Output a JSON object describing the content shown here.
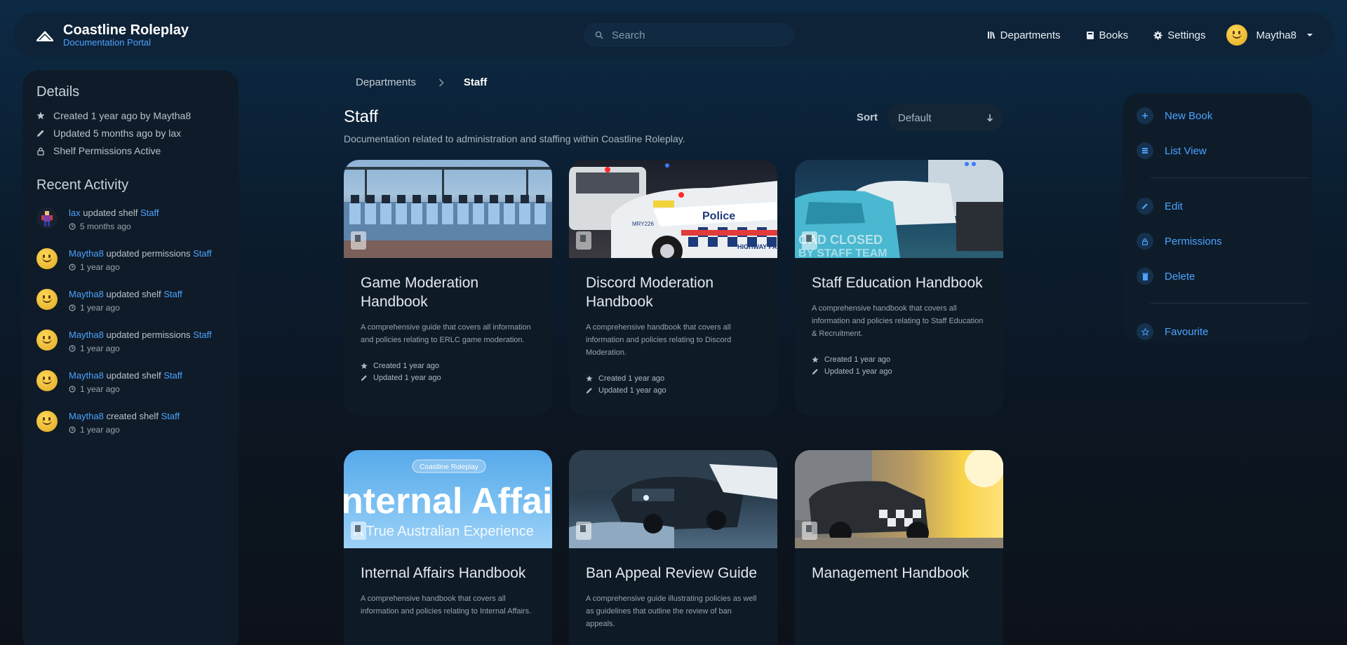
{
  "header": {
    "brand_title": "Coastline Roleplay",
    "brand_subtitle": "Documentation Portal",
    "search_placeholder": "Search",
    "nav": [
      {
        "label": "Departments",
        "icon": "departments-icon"
      },
      {
        "label": "Books",
        "icon": "books-icon"
      },
      {
        "label": "Settings",
        "icon": "gear-icon"
      }
    ],
    "user_name": "Maytha8"
  },
  "details": {
    "heading": "Details",
    "rows": [
      {
        "icon": "star-icon",
        "text": "Created 1 year ago by Maytha8"
      },
      {
        "icon": "pencil-icon",
        "text": "Updated 5 months ago by lax"
      },
      {
        "icon": "lock-icon",
        "text": "Shelf Permissions Active"
      }
    ]
  },
  "recent_activity": {
    "heading": "Recent Activity",
    "items": [
      {
        "user": "lax",
        "action": "updated shelf",
        "target": "Staff",
        "time": "5 months ago"
      },
      {
        "user": "Maytha8",
        "action": "updated permissions",
        "target": "Staff",
        "time": "1 year ago"
      },
      {
        "user": "Maytha8",
        "action": "updated shelf",
        "target": "Staff",
        "time": "1 year ago"
      },
      {
        "user": "Maytha8",
        "action": "updated permissions",
        "target": "Staff",
        "time": "1 year ago"
      },
      {
        "user": "Maytha8",
        "action": "updated shelf",
        "target": "Staff",
        "time": "1 year ago"
      },
      {
        "user": "Maytha8",
        "action": "created shelf",
        "target": "Staff",
        "time": "1 year ago"
      }
    ]
  },
  "breadcrumb": {
    "parent": "Departments",
    "current": "Staff"
  },
  "main": {
    "title": "Staff",
    "description": "Documentation related to administration and staffing within Coastline Roleplay.",
    "sort_label": "Sort",
    "sort_value": "Default"
  },
  "books": [
    {
      "title": "Game Moderation Handbook",
      "desc": "A comprehensive guide that covers all information and policies relating to ERLC game moderation.",
      "created": "Created 1 year ago",
      "updated": "Updated 1 year ago"
    },
    {
      "title": "Discord Moderation Handbook",
      "desc": "A comprehensive handbook that covers all information and policies relating to Discord Moderation.",
      "created": "Created 1 year ago",
      "updated": "Updated 1 year ago"
    },
    {
      "title": "Staff Education Handbook",
      "desc": "A comprehensive handbook that covers all information and policies relating to Staff Education & Recruitment.",
      "created": "Created 1 year ago",
      "updated": "Updated 1 year ago"
    },
    {
      "title": "Internal Affairs Handbook",
      "desc": "A comprehensive handbook that covers all information and policies relating to Internal Affairs.",
      "cover_text_top": "Coastline Roleplay",
      "cover_text_main": "nternal Affai",
      "cover_text_sub": "A True Australian Experience"
    },
    {
      "title": "Ban Appeal Review Guide",
      "desc": "A comprehensive guide illustrating policies as well as guidelines that outline the review of ban appeals."
    },
    {
      "title": "Management Handbook",
      "desc": ""
    }
  ],
  "cover_text": {
    "card2_police": "Police",
    "card2_plate": "MRY226",
    "card2_highway": "HIGHWAY PA",
    "card3_sign_1": "OAD CLOSED",
    "card3_sign_2": "BY STAFF TEAM"
  },
  "actions": [
    {
      "label": "New Book",
      "icon": "plus-icon"
    },
    {
      "label": "List View",
      "icon": "list-icon"
    },
    {
      "label": "Edit",
      "icon": "pencil-icon"
    },
    {
      "label": "Permissions",
      "icon": "lock-icon"
    },
    {
      "label": "Delete",
      "icon": "trash-icon"
    },
    {
      "label": "Favourite",
      "icon": "star-icon"
    }
  ],
  "colors": {
    "accent": "#4ba3ff",
    "background": "#0b1c2e"
  }
}
